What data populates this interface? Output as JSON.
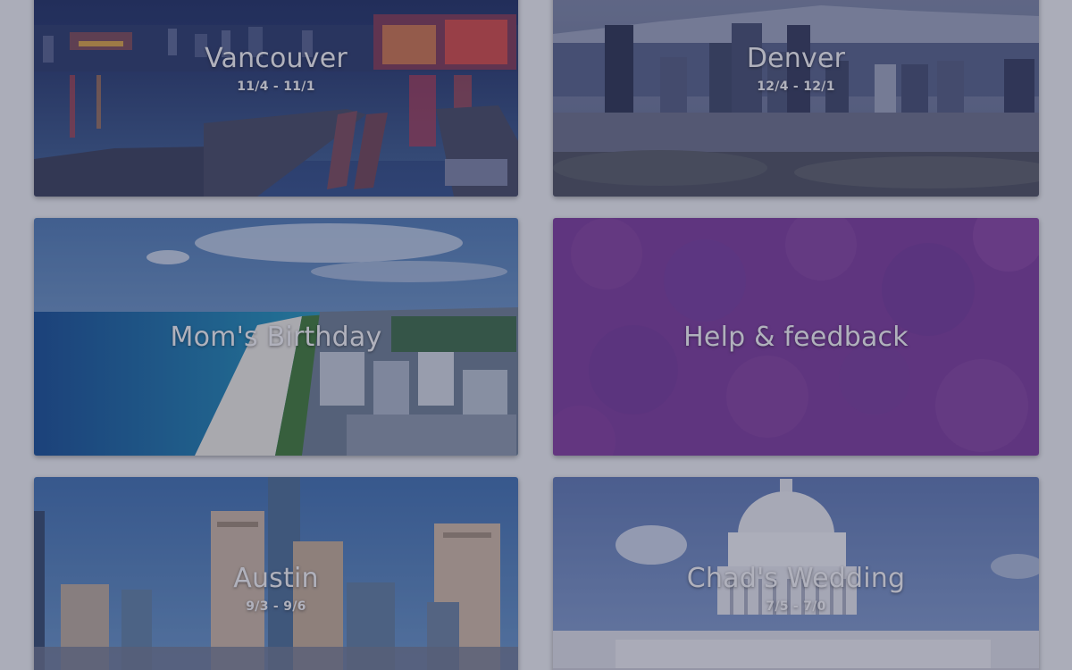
{
  "trips": [
    {
      "title": "Vancouver",
      "dates": "11/4 - 11/1"
    },
    {
      "title": "Denver",
      "dates": "12/4 - 12/1"
    },
    {
      "title": "Mom's Birthday",
      "dates": ""
    },
    {
      "title": "Austin",
      "dates": "9/3 - 9/6"
    },
    {
      "title": "Chad's Wedding",
      "dates": "7/5 - 7/0"
    }
  ],
  "help": {
    "title": "Help & feedback"
  },
  "colors": {
    "overlay": "rgba(40,44,70,0.33)",
    "help_card": "#7b3b9b",
    "page_background": "#eceef2"
  }
}
